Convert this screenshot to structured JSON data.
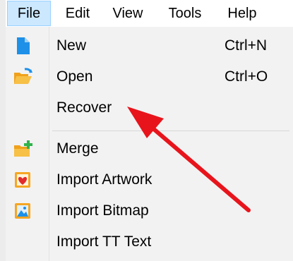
{
  "menubar": {
    "items": [
      {
        "label": "File"
      },
      {
        "label": "Edit"
      },
      {
        "label": "View"
      },
      {
        "label": "Tools"
      },
      {
        "label": "Help"
      }
    ]
  },
  "file_menu": {
    "items": [
      {
        "label": "New",
        "shortcut": "Ctrl+N",
        "icon": "new-document-icon"
      },
      {
        "label": "Open",
        "shortcut": "Ctrl+O",
        "icon": "open-folder-icon"
      },
      {
        "label": "Recover",
        "shortcut": "",
        "icon": ""
      },
      {
        "label": "Merge",
        "shortcut": "",
        "icon": "merge-folder-icon"
      },
      {
        "label": "Import Artwork",
        "shortcut": "",
        "icon": "import-artwork-icon"
      },
      {
        "label": "Import Bitmap",
        "shortcut": "",
        "icon": "import-bitmap-icon"
      },
      {
        "label": "Import TT Text",
        "shortcut": "",
        "icon": ""
      }
    ]
  },
  "annotation": {
    "arrow_color": "#e8141c",
    "points_to": "Recover"
  },
  "colors": {
    "menu_highlight": "#cce8ff",
    "menu_highlight_border": "#99d1ff",
    "panel_bg": "#f2f2f2",
    "icon_blue": "#1e90e8",
    "icon_orange": "#f5a623"
  }
}
